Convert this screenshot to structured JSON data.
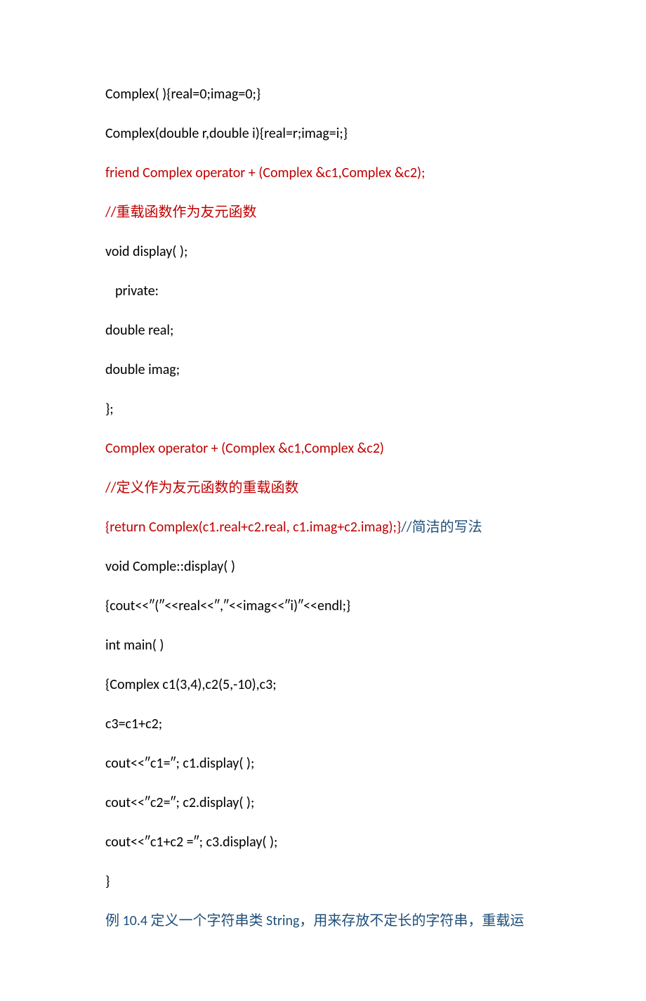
{
  "lines": {
    "l1": "Complex( ){real=0;imag=0;}",
    "l2": "Complex(double r,double i){real=r;imag=i;}",
    "l3": "friend Complex operator + (Complex &c1,Complex &c2);",
    "l4_prefix": "//",
    "l4_cn": "重载函数作为友元函数",
    "l5": "void display( );",
    "l6": "private:",
    "l7": "double real;",
    "l8": "double imag;",
    "l9": "};",
    "l10": "Complex operator + (Complex &c1,Complex &c2)",
    "l11_prefix": "//",
    "l11_cn": "定义作为友元函数的重载函数",
    "l12_red": "{return Complex(c1.real+c2.real, c1.imag+c2.imag);}",
    "l12_blue_prefix": "//",
    "l12_blue_cn": "简洁的写法",
    "l13": "void Comple::display( )",
    "l14": "{cout<<″(″<<real<<″,″<<imag<<″i)″<<endl;}",
    "l15": "int main( )",
    "l16": "{Complex c1(3,4),c2(5,-10),c3;",
    "l17": "c3=c1+c2;",
    "l18": "cout<<″c1=″; c1.display( );",
    "l19": "cout<<″c2=″; c2.display( );",
    "l20": "cout<<″c1+c2 =″; c3.display( );",
    "l21": "}",
    "l22_a_cn": "例",
    "l22_b": " 10.4  ",
    "l22_c_cn": "定义一个字符串类",
    "l22_d": " String",
    "l22_e_cn": "，用来存放不定长的字符串，重载运"
  }
}
